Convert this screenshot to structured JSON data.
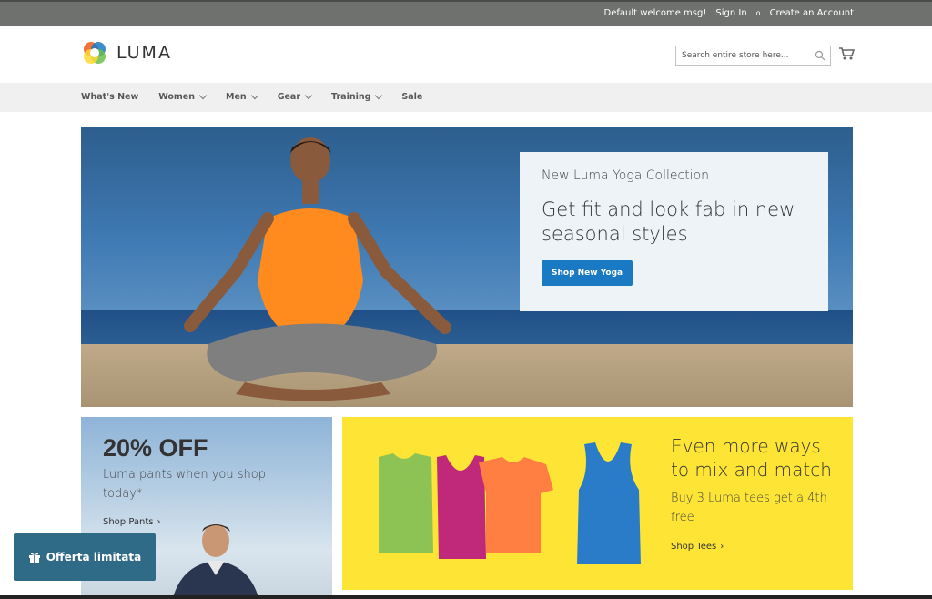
{
  "topbar": {
    "welcome": "Default welcome msg!",
    "sign_in": "Sign In",
    "separator": "o",
    "create_account": "Create an Account"
  },
  "header": {
    "logo_text": "LUMA",
    "search_placeholder": "Search entire store here...",
    "search_icon": "search-icon",
    "cart_icon": "cart-icon"
  },
  "nav": {
    "items": [
      {
        "label": "What's New"
      },
      {
        "label": "Women"
      },
      {
        "label": "Men"
      },
      {
        "label": "Gear"
      },
      {
        "label": "Training"
      },
      {
        "label": "Sale"
      }
    ]
  },
  "hero": {
    "subtitle": "New Luma Yoga Collection",
    "title": "Get fit and look fab in new seasonal styles",
    "button": "Shop New Yoga"
  },
  "promo_pants": {
    "title": "20% OFF",
    "text": "Luma pants when you shop today*",
    "link": "Shop Pants"
  },
  "promo_tees": {
    "title": "Even more ways to mix and match",
    "text": "Buy 3 Luma tees get a 4th free",
    "link": "Shop Tees"
  },
  "offer": {
    "label": "Offerta limitata",
    "icon": "gift-icon"
  },
  "colors": {
    "topbar": "#6e716e",
    "nav": "#f0f0f0",
    "primary_button": "#1979c3",
    "promo_yellow": "#fde435",
    "offer_button": "#2f6a87"
  }
}
